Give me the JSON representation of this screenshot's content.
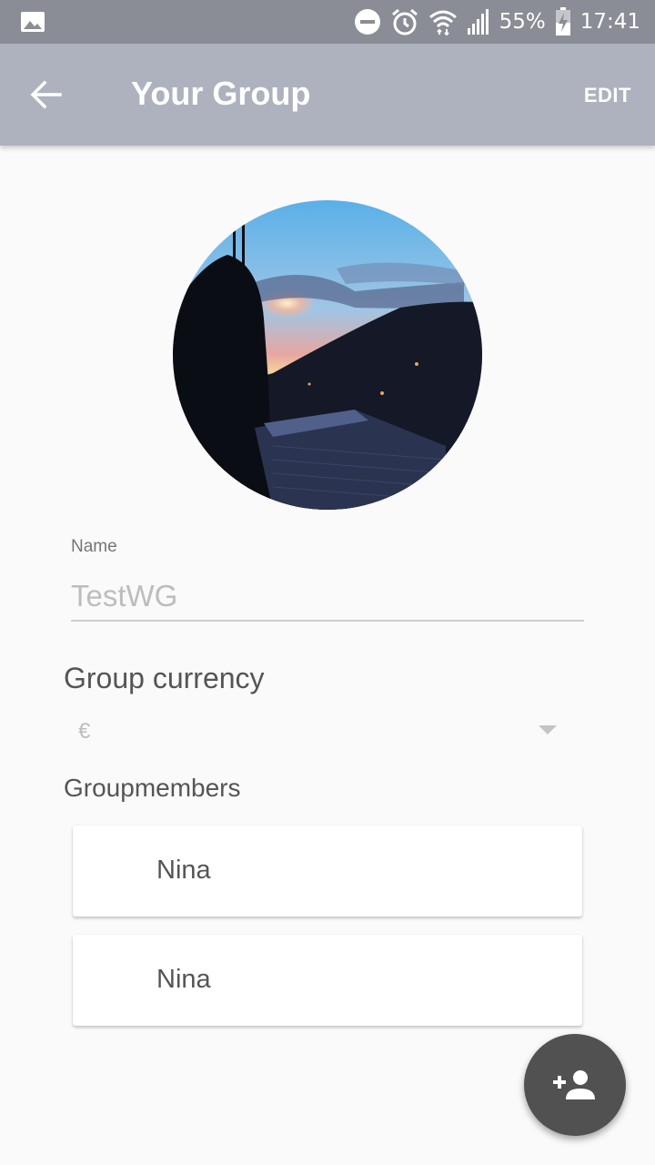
{
  "status_bar": {
    "battery": "55%",
    "time": "17:41",
    "icons": [
      "gallery-icon",
      "dnd-icon",
      "alarm-icon",
      "wifi-icon",
      "signal-icon",
      "battery-charging-icon"
    ]
  },
  "app_bar": {
    "back_icon": "arrow-left-icon",
    "title": "Your Group",
    "edit_label": "EDIT",
    "background": "#aeb1be"
  },
  "group": {
    "avatar_icon": "group-photo",
    "name_label": "Name",
    "name_value": "TestWG",
    "currency_heading": "Group currency",
    "currency_value": "€",
    "members_heading": "Groupmembers",
    "members": [
      {
        "name": "Nina"
      },
      {
        "name": "Nina"
      }
    ]
  },
  "fab": {
    "icon": "add-person-icon",
    "color": "#515151"
  }
}
